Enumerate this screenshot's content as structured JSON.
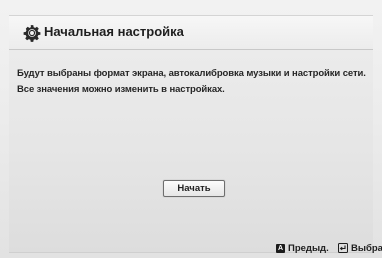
{
  "dialog": {
    "title": "Начальная настройка",
    "icon": "gear-icon"
  },
  "message": {
    "line1": "Будут выбраны формат экрана, автокалибровка музыки и настройки сети.",
    "line2": "Все значения можно изменить в настройках."
  },
  "buttons": {
    "start_label": "Начать"
  },
  "footer": {
    "prev_key": "A",
    "prev_label": "Предыд.",
    "select_label": "Выбрать"
  }
}
